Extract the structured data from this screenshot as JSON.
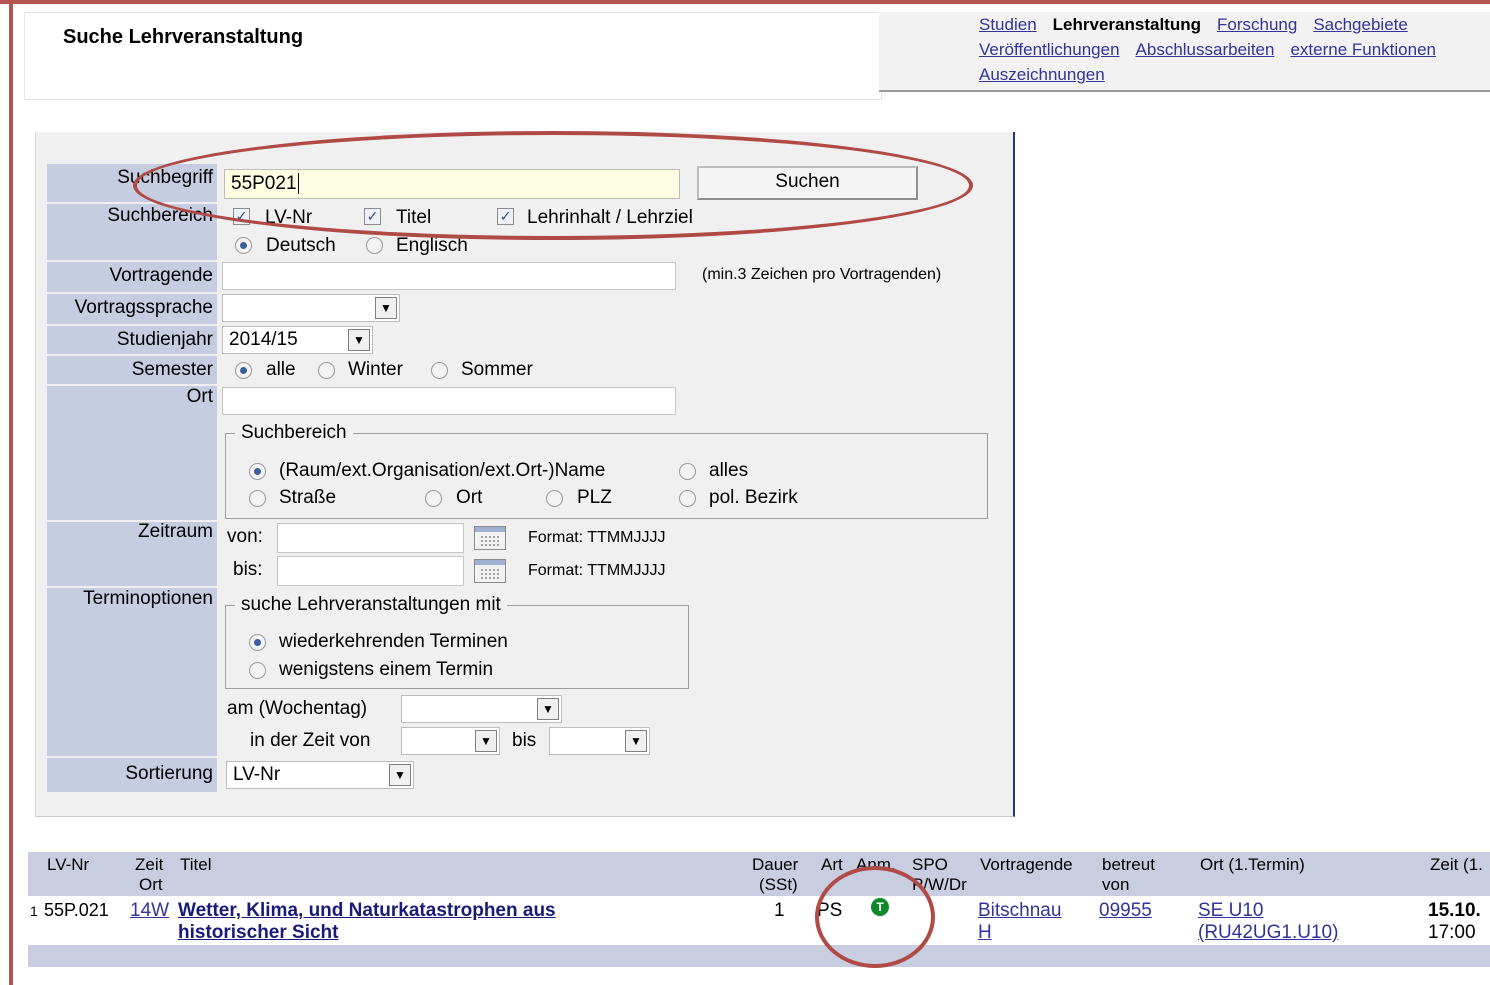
{
  "page_title": "Suche Lehrveranstaltung",
  "nav": {
    "items": [
      {
        "label": "Studien",
        "link": true
      },
      {
        "label": "Lehrveranstaltung",
        "link": false
      },
      {
        "label": "Forschung",
        "link": true
      },
      {
        "label": "Sachgebiete",
        "link": true
      },
      {
        "label": "Veröffentlichungen",
        "link": true
      },
      {
        "label": "Abschlussarbeiten",
        "link": true
      },
      {
        "label": "externe Funktionen",
        "link": true
      },
      {
        "label": "Auszeichnungen",
        "link": true
      }
    ]
  },
  "form": {
    "suchbegriff_label": "Suchbegriff",
    "suchbegriff_value": "55P021",
    "suchen_button": "Suchen",
    "suchbereich_label": "Suchbereich",
    "check_lvnr": "LV-Nr",
    "check_titel": "Titel",
    "check_lehrinhalt": "Lehrinhalt / Lehrziel",
    "radio_deutsch": "Deutsch",
    "radio_englisch": "Englisch",
    "vortragende_label": "Vortragende",
    "vortragende_hint": "(min.3 Zeichen pro Vortragenden)",
    "vortragssprache_label": "Vortragssprache",
    "vortragssprache_value": "",
    "studienjahr_label": "Studienjahr",
    "studienjahr_value": "2014/15",
    "semester_label": "Semester",
    "semester_alle": "alle",
    "semester_winter": "Winter",
    "semester_sommer": "Sommer",
    "ort_label": "Ort",
    "ort_fieldset_legend": "Suchbereich",
    "ort_opt_name": "(Raum/ext.Organisation/ext.Ort-)Name",
    "ort_opt_alles": "alles",
    "ort_opt_strasse": "Straße",
    "ort_opt_ort": "Ort",
    "ort_opt_plz": "PLZ",
    "ort_opt_bezirk": "pol. Bezirk",
    "zeitraum_label": "Zeitraum",
    "von_label": "von:",
    "bis_label": "bis:",
    "format_hint": "Format: TTMMJJJJ",
    "terminoptionen_label": "Terminoptionen",
    "termin_legend": "suche Lehrveranstaltungen mit",
    "termin_opt1": "wiederkehrenden Terminen",
    "termin_opt2": "wenigstens einem Termin",
    "wochentag_label": "am (Wochentag)",
    "zeit_von_label": "in der Zeit von",
    "zeit_bis_label": "bis",
    "sortierung_label": "Sortierung",
    "sortierung_value": "LV-Nr"
  },
  "results": {
    "headers": {
      "lvnr": "LV-Nr",
      "zeit": "Zeit",
      "ort": "Ort",
      "titel": "Titel",
      "dauer": "Dauer",
      "sst": "(SSt)",
      "art": "Art",
      "anm": "Anm.",
      "spo": "SPO",
      "pwdr": "P/W/Dr",
      "vortragende": "Vortragende",
      "betreut": "betreut",
      "von": "von",
      "ort1": "Ort (1.Termin)",
      "zeit1": "Zeit (1."
    },
    "rows": [
      {
        "index": "1",
        "lvnr": "55P.021",
        "zeit": "14W",
        "titel_line1": "Wetter, Klima, und Naturkatastrophen aus",
        "titel_line2": "historischer Sicht",
        "dauer": "1",
        "art": "PS",
        "anm_icon": "T",
        "vortragende_line1": "Bitschnau",
        "vortragende_line2": "H",
        "betreut": "09955",
        "ort1_line1": "SE U10",
        "ort1_line2": "(RU42UG1.U10)",
        "zeit1_line1": "15.10.",
        "zeit1_line2": "17:00"
      }
    ]
  },
  "colors": {
    "frame": "#b35450",
    "label_bg": "#c6cde0",
    "link": "#333399",
    "annotation": "#b04a47",
    "anm_dot": "#0e8a2a"
  }
}
